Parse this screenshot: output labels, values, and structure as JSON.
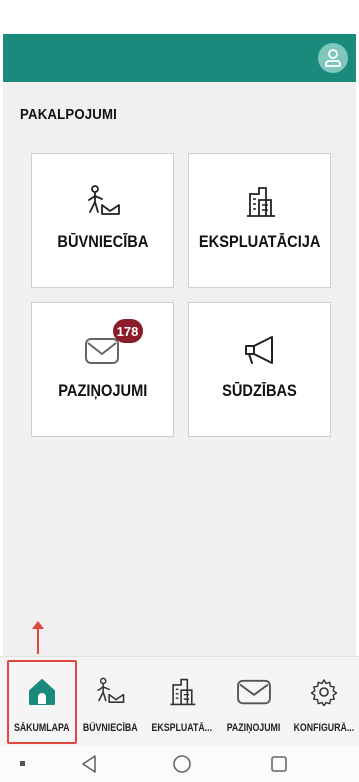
{
  "header": {
    "profile_icon": "user-icon",
    "brand_color": "#1a8a7d"
  },
  "content": {
    "section_title": "PAKALPOJUMI",
    "tiles": [
      {
        "label": "BŪVNIECĪBA",
        "icon": "construction-worker-icon"
      },
      {
        "label": "EKSPLUATĀCIJA",
        "icon": "building-icon"
      },
      {
        "label": "PAZIŅOJUMI",
        "icon": "mail-icon",
        "badge": "178"
      },
      {
        "label": "SŪDZĪBAS",
        "icon": "megaphone-icon"
      }
    ]
  },
  "bottom_nav": {
    "items": [
      {
        "label": "SĀKUMLAPA",
        "icon": "home-icon",
        "active": true
      },
      {
        "label": "BŪVNIECĪBA",
        "icon": "construction-worker-icon"
      },
      {
        "label": "EKSPLUATĀ...",
        "icon": "building-icon"
      },
      {
        "label": "PAZIŅOJUMI",
        "icon": "mail-icon"
      },
      {
        "label": "KONFIGURĀ...",
        "icon": "gear-icon"
      }
    ]
  },
  "system_nav": {
    "icons": [
      "recent-dot-icon",
      "back-icon",
      "home-circle-icon",
      "overview-icon"
    ]
  },
  "colors": {
    "accent": "#1a8a7d",
    "badge": "#8c1c2a",
    "highlight": "#e0463c"
  }
}
